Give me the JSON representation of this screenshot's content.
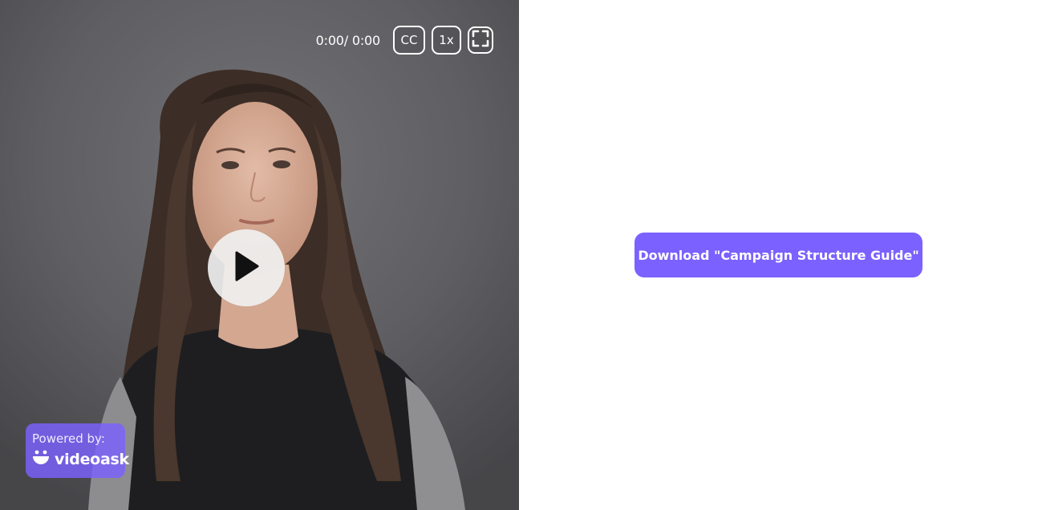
{
  "player": {
    "time_display": "0:00/ 0:00",
    "cc_label": "CC",
    "speed_label": "1x",
    "fullscreen_icon": "fullscreen-icon",
    "play_icon": "play-icon"
  },
  "branding": {
    "powered_label": "Powered by:",
    "brand_name": "videoask",
    "brand_icon": "videoask-logo-icon",
    "badge_color": "#7b61ff"
  },
  "cta": {
    "download_label": "Download \"Campaign Structure Guide\"",
    "button_color": "#7b61ff"
  }
}
